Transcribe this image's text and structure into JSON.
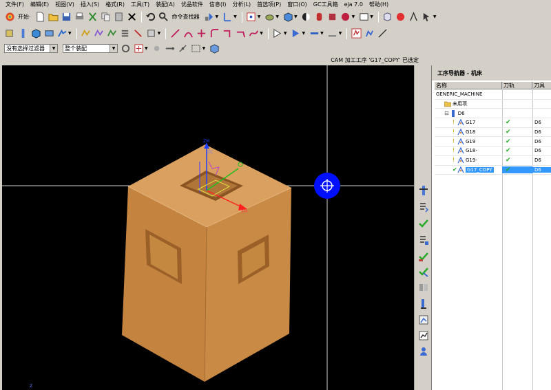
{
  "menu": {
    "items": [
      "文件(F)",
      "编辑(E)",
      "视图(V)",
      "插入(S)",
      "格式(R)",
      "工具(T)",
      "装配(A)",
      "优品软件",
      "信息(I)",
      "分析(L)",
      "首选项(P)",
      "窗口(O)",
      "GC工具箱",
      "eja 7.0",
      "帮助(H)"
    ]
  },
  "toolbar": {
    "start_label": "开始·",
    "command_finder_label": "命令查找器"
  },
  "filters": {
    "selection_filter": "没有选择过滤器",
    "assembly_scope": "整个装配"
  },
  "status": {
    "message": "CAM 加工工序 'G17_COPY' 已选定"
  },
  "viewport": {
    "background": "#000000",
    "part_color": "#c8823f",
    "axis_labels": {
      "zm": "ZM",
      "xm": "XM",
      "zc": "ZC"
    },
    "corner_label": "Z"
  },
  "navigator": {
    "title": "工序导航器 - 机床",
    "columns": {
      "name": "名称",
      "path": "刀轨",
      "tool": "刀具"
    },
    "rows": [
      {
        "name": "GENERIC_MACHINE",
        "indent": 0,
        "icon": "machine-icon",
        "path": "",
        "tool": ""
      },
      {
        "name": "未用项",
        "indent": 1,
        "icon": "folder-icon",
        "path": "",
        "tool": ""
      },
      {
        "name": "D6",
        "indent": 1,
        "icon": "tool-icon",
        "path": "",
        "tool": ""
      },
      {
        "name": "G17",
        "indent": 2,
        "icon": "operation-icon",
        "path": "✔",
        "tool": "D6"
      },
      {
        "name": "G18",
        "indent": 2,
        "icon": "operation-icon",
        "path": "✔",
        "tool": "D6"
      },
      {
        "name": "G19",
        "indent": 2,
        "icon": "operation-icon",
        "path": "✔",
        "tool": "D6"
      },
      {
        "name": "G18-",
        "indent": 2,
        "icon": "operation-icon",
        "path": "✔",
        "tool": "D6"
      },
      {
        "name": "G19-",
        "indent": 2,
        "icon": "operation-icon",
        "path": "✔",
        "tool": "D6"
      },
      {
        "name": "G17_COPY",
        "indent": 2,
        "icon": "operation-icon",
        "path": "✔",
        "tool": "D6",
        "selected": true
      }
    ]
  },
  "colors": {
    "accent": "#3399ff",
    "check": "#1faa1f",
    "ui_bg": "#d4d0c8"
  }
}
